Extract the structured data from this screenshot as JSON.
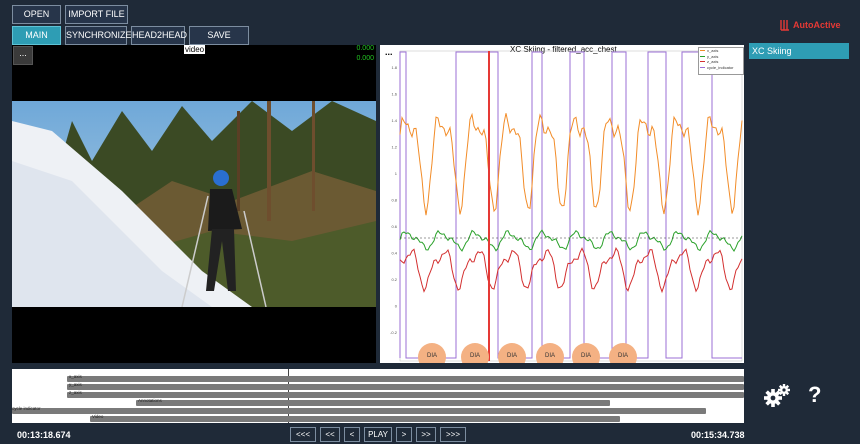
{
  "toolbar": {
    "open": "OPEN",
    "import_file": "IMPORT FILE",
    "tabs": [
      "MAIN PAGE",
      "SYNCHRONIZE",
      "HEAD2HEAD",
      "SAVE PROJECT"
    ]
  },
  "brand": {
    "name": "AutoActive",
    "color": "#e53935"
  },
  "video": {
    "title": "video",
    "menu": "...",
    "readouts": [
      "0.000",
      "0.000"
    ]
  },
  "plot": {
    "menu": "...",
    "chart_data": {
      "type": "line",
      "title": "XC Skiing - filtered_acc_chest",
      "legend": [
        "x_axis",
        "y_axis",
        "z_axis",
        "cycle_indicator"
      ],
      "legend_position": "top-right",
      "series_colors": [
        "#f28c28",
        "#2aa12a",
        "#d32f2f",
        "#9b6fd6"
      ],
      "y_ticks": [
        "1.8",
        "1.6",
        "1.4",
        "1.2",
        "1",
        "0.8",
        "0.6",
        "0.4",
        "0.2",
        "0",
        "-0.2"
      ],
      "ylim": [
        -0.2,
        1.8
      ],
      "cycle_labels": [
        "DIA",
        "DIA",
        "DIA",
        "DIA",
        "DIA",
        "DIA"
      ],
      "marker_color": "#e53935"
    }
  },
  "data_list": {
    "items": [
      "XC Skiing"
    ]
  },
  "timeline": {
    "rows": [
      "x_axis",
      "y_axis",
      "z_axis",
      "Annotations",
      "cycle indicator",
      "Video"
    ]
  },
  "transport": {
    "start_time": "00:13:18.674",
    "end_time": "00:15:34.738",
    "buttons": [
      "<<<",
      "<<",
      "<",
      "PLAY",
      ">",
      ">>",
      ">>>"
    ]
  },
  "icons": {
    "settings": "gears-icon",
    "help": "question-icon"
  }
}
